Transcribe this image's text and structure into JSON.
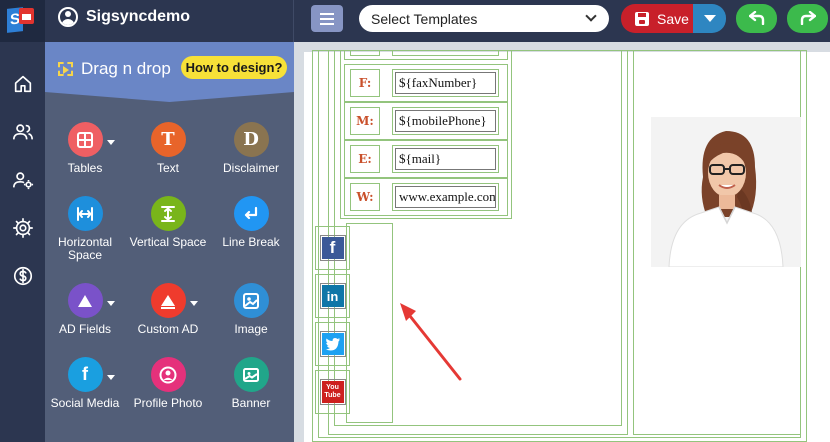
{
  "app": {
    "account_name": "Sigsyncdemo"
  },
  "toolbar": {
    "template_select_value": "Select Templates",
    "save_label": "Save",
    "undo_icon": "undo-arrow-icon",
    "redo_icon": "redo-arrow-icon"
  },
  "colors": {
    "topbar": "#2c3650",
    "panel": "#525e78",
    "panel_header": "#6a86c6",
    "save": "#c8202a",
    "save_dropdown": "#2e86c1",
    "undo_redo": "#3cba4c",
    "cell_border": "#93c47d",
    "label_text": "#c9502b",
    "annotation_arrow": "#e53935"
  },
  "rail": [
    {
      "name": "home-icon"
    },
    {
      "name": "users-icon"
    },
    {
      "name": "user-settings-icon"
    },
    {
      "name": "settings-gear-icon"
    },
    {
      "name": "dollar-icon"
    }
  ],
  "panel": {
    "title": "Drag n drop",
    "how_to_label": "How to design?",
    "components": [
      {
        "label": "Tables",
        "icon": "table-icon",
        "color": "#ef5f63",
        "dropdown": true
      },
      {
        "label": "Text",
        "icon": "text-t-icon",
        "glyph": "T",
        "color": "#e8642a",
        "dropdown": false
      },
      {
        "label": "Disclaimer",
        "icon": "disclaimer-d-icon",
        "glyph": "D",
        "color": "#8a7450",
        "dropdown": false
      },
      {
        "label": "Horizontal Space",
        "icon": "horizontal-space-icon",
        "color": "#1e8fdc",
        "dropdown": false
      },
      {
        "label": "Vertical Space",
        "icon": "vertical-space-icon",
        "color": "#79b51a",
        "dropdown": false
      },
      {
        "label": "Line Break",
        "icon": "line-break-icon",
        "color": "#2196f3",
        "dropdown": false
      },
      {
        "label": "AD Fields",
        "icon": "ad-fields-icon",
        "color": "#7a52c9",
        "dropdown": true
      },
      {
        "label": "Custom AD",
        "icon": "custom-ad-icon",
        "color": "#ef3b2d",
        "dropdown": true
      },
      {
        "label": "Image",
        "icon": "image-icon",
        "color": "#2f8fd6",
        "dropdown": false
      },
      {
        "label": "Social Media",
        "icon": "social-media-icon",
        "glyph": "f",
        "color": "#1a9fe0",
        "dropdown": true
      },
      {
        "label": "Profile Photo",
        "icon": "profile-photo-icon",
        "color": "#e5317b",
        "dropdown": false
      },
      {
        "label": "Banner",
        "icon": "banner-icon",
        "color": "#21a68a",
        "dropdown": false
      }
    ]
  },
  "signature": {
    "fields": [
      {
        "label": "F:",
        "value": "${faxNumber}"
      },
      {
        "label": "M:",
        "value": "${mobilePhone}"
      },
      {
        "label": "E:",
        "value": "${mail}"
      },
      {
        "label": "W:",
        "value": "www.example.com"
      }
    ],
    "social": [
      {
        "name": "facebook",
        "icon": "facebook-icon",
        "glyph": "f",
        "color": "#3b5998"
      },
      {
        "name": "linkedin",
        "icon": "linkedin-icon",
        "glyph": "in",
        "color": "#0e76a8"
      },
      {
        "name": "twitter",
        "icon": "twitter-icon",
        "glyph": "",
        "color": "#1da1f2"
      },
      {
        "name": "youtube",
        "icon": "youtube-icon",
        "glyph": "You Tube",
        "color": "#cd201f"
      }
    ],
    "photo_icon": "profile-photo-portrait"
  }
}
